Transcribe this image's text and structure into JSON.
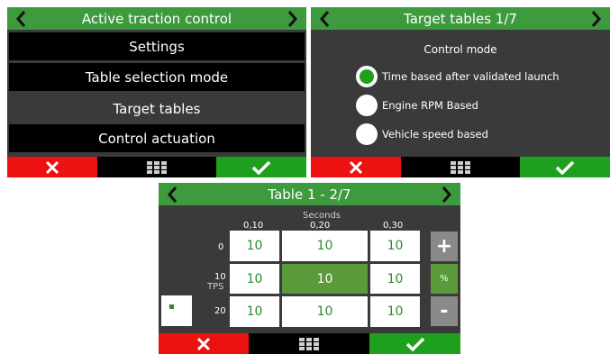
{
  "panel1": {
    "title": "Active traction control",
    "menu": [
      "Settings",
      "Table selection mode",
      "Target tables",
      "Control actuation"
    ],
    "selected_index": 2
  },
  "panel2": {
    "title": "Target tables 1/7",
    "section_label": "Control mode",
    "options": [
      {
        "label": "Time based after validated launch",
        "selected": true
      },
      {
        "label": "Engine RPM Based",
        "selected": false
      },
      {
        "label": "Vehicle speed based",
        "selected": false
      }
    ]
  },
  "panel3": {
    "title": "Table 1 - 2/7",
    "x_axis_label": "Seconds",
    "x_values": [
      "0,10",
      "0,20",
      "0,30"
    ],
    "y_axis_label": "TPS",
    "y_values": [
      "0",
      "10",
      "20"
    ],
    "cells": [
      [
        "10",
        "10",
        "10"
      ],
      [
        "10",
        "10",
        "10"
      ],
      [
        "10",
        "10",
        "10"
      ]
    ],
    "active_cell": [
      1,
      1
    ],
    "plus_label": "+",
    "percent_label": "%",
    "minus_label": "-"
  },
  "colors": {
    "header_green": "#3d9a3d",
    "cancel_red": "#ee1111",
    "ok_green": "#1ea01e",
    "active_cell": "#5b9a3b"
  },
  "icons": {
    "prev": "chevron-left-icon",
    "next": "chevron-right-icon",
    "cancel": "x-icon",
    "menu": "grid-icon",
    "confirm": "checkmark-icon"
  }
}
